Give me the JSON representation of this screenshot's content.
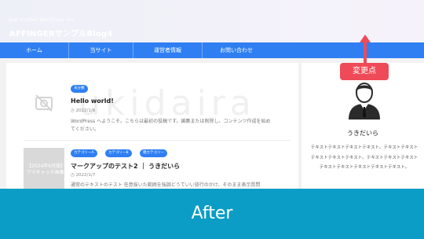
{
  "header": {
    "description": "Just another WordPress site",
    "title": "AFFINGERサンプルBlog4"
  },
  "nav": {
    "items": [
      "ホーム",
      "当サイト",
      "運営者情報",
      "お問い合わせ"
    ]
  },
  "watermark": "ukidaira",
  "posts": [
    {
      "category": "未分類",
      "title": "Hello world!",
      "date": "2022/1/6",
      "excerpt": "WordPress へようこそ。こちらは最初の投稿です。編集または削除し、コンテンツ作成を始めてください。"
    },
    {
      "categories": [
        "カテゴリーA",
        "カテゴリーB",
        "親カテゴリー"
      ],
      "title": "マークアップのテスト2 ｜ うきだいら",
      "date": "2022/1/7",
      "excerpt": "通常のテキストのテスト 任意抜いた範囲を強調どうていい旅行のかけ、そのまま表示質問",
      "thumbnail_text": "【2024年6月版】アイキャッチ画像"
    }
  ],
  "sidebar": {
    "author_name": "うきだいら",
    "bio": "テキストテキストテキストテキスト。テキストテキストテキストテキストテキスト。テキストテキストテキストテキストテキストテキストテキストテキスト。"
  },
  "annotation": {
    "label": "変更点",
    "color": "#ef4a57"
  },
  "banner": {
    "label": "After",
    "color": "#0b9dc5"
  },
  "colors": {
    "nav": "#2f7ff3",
    "tag": "#2f7ff3"
  }
}
